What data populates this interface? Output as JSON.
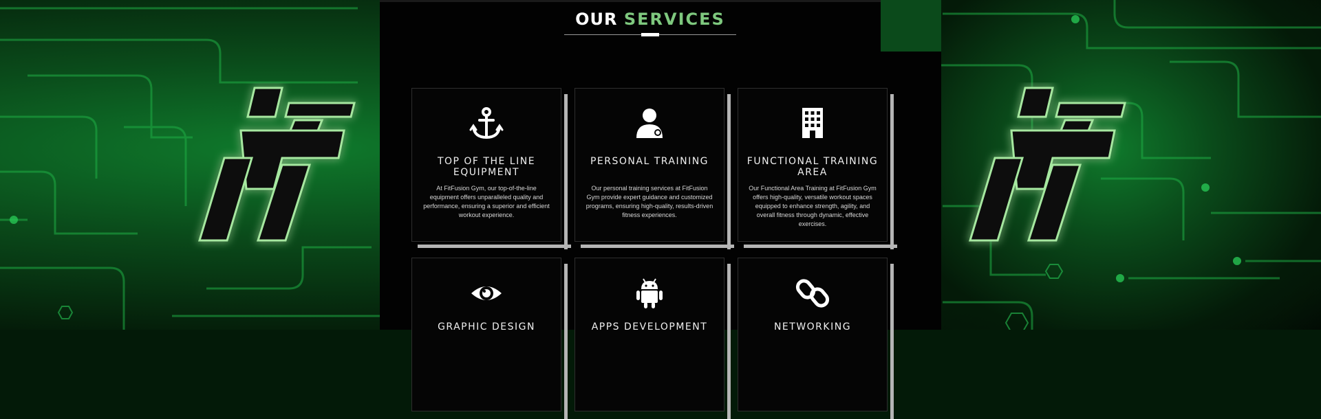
{
  "header": {
    "title_word_1": "OUR",
    "title_word_2": "SERVICES"
  },
  "colors": {
    "accent_green": "#7ec87e",
    "panel_bg": "#020202",
    "circuit_green": "#1fae45"
  },
  "services": [
    {
      "icon": "anchor-icon",
      "title": "TOP OF THE LINE EQUIPMENT",
      "description": "At FitFusion Gym, our top-of-the-line equipment offers unparalleled quality and performance, ensuring a superior and efficient workout experience."
    },
    {
      "icon": "user-icon",
      "title": "PERSONAL TRAINING",
      "description": "Our personal training services at FitFusion Gym provide expert guidance and customized programs, ensuring high-quality, results-driven fitness experiences."
    },
    {
      "icon": "building-icon",
      "title": "FUNCTIONAL TRAINING AREA",
      "description": "Our Functional Area Training at FitFusion Gym offers high-quality, versatile workout spaces equipped to enhance strength, agility, and overall fitness through dynamic, effective exercises."
    },
    {
      "icon": "eye-icon",
      "title": "GRAPHIC DESIGN",
      "description": ""
    },
    {
      "icon": "android-icon",
      "title": "APPS DEVELOPMENT",
      "description": ""
    },
    {
      "icon": "link-icon",
      "title": "NETWORKING",
      "description": ""
    }
  ]
}
